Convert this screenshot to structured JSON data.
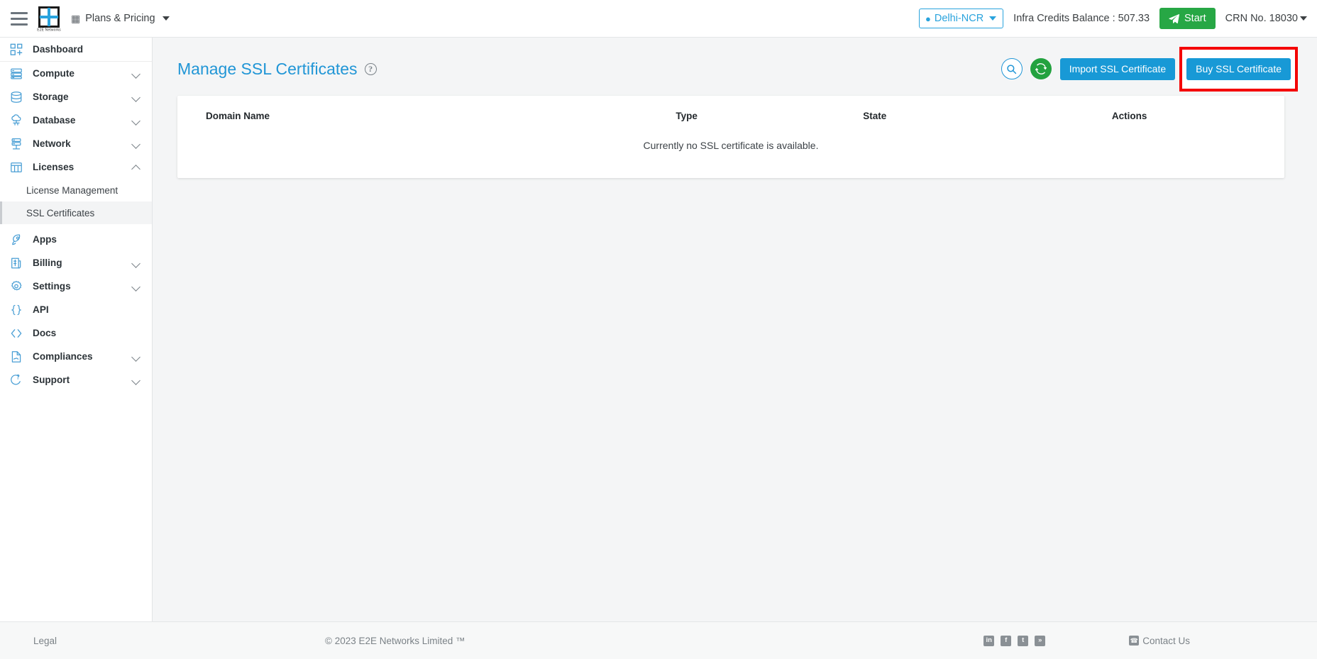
{
  "topbar": {
    "menu_icon": "hamburger-icon",
    "logo_text": "E2E Networks",
    "plans_label": "Plans & Pricing",
    "plans_icon": "list-icon",
    "region": "Delhi-NCR",
    "region_icon": "map-pin-icon",
    "credits_label": "Infra Credits Balance : 507.33",
    "start_label": "Start",
    "start_icon": "paper-plane-icon",
    "crn_label": "CRN No. 18030"
  },
  "sidebar": {
    "items": [
      {
        "label": "Dashboard",
        "icon": "dashboard-icon",
        "expandable": false,
        "state": ""
      },
      {
        "label": "Compute",
        "icon": "server-icon",
        "expandable": true,
        "state": "collapsed"
      },
      {
        "label": "Storage",
        "icon": "database-icon",
        "expandable": true,
        "state": "collapsed"
      },
      {
        "label": "Database",
        "icon": "cloud-db-icon",
        "expandable": true,
        "state": "collapsed"
      },
      {
        "label": "Network",
        "icon": "network-icon",
        "expandable": true,
        "state": "collapsed"
      },
      {
        "label": "Licenses",
        "icon": "grid-icon",
        "expandable": true,
        "state": "expanded"
      },
      {
        "label": "Apps",
        "icon": "rocket-icon",
        "expandable": false,
        "state": ""
      },
      {
        "label": "Billing",
        "icon": "invoice-icon",
        "expandable": true,
        "state": "collapsed"
      },
      {
        "label": "Settings",
        "icon": "gear-icon",
        "expandable": true,
        "state": "collapsed"
      },
      {
        "label": "API",
        "icon": "braces-icon",
        "expandable": false,
        "state": ""
      },
      {
        "label": "Docs",
        "icon": "code-icon",
        "expandable": false,
        "state": ""
      },
      {
        "label": "Compliances",
        "icon": "document-icon",
        "expandable": true,
        "state": "collapsed"
      },
      {
        "label": "Support",
        "icon": "lifebuoy-icon",
        "expandable": true,
        "state": "collapsed"
      }
    ],
    "licenses_sub": [
      {
        "label": "License Management",
        "active": false
      },
      {
        "label": "SSL Certificates",
        "active": true
      }
    ]
  },
  "main": {
    "title": "Manage SSL Certificates",
    "help_icon": "question-mark-icon",
    "search_icon": "search-icon",
    "refresh_icon": "refresh-icon",
    "import_label": "Import SSL Certificate",
    "buy_label": "Buy SSL Certificate",
    "table": {
      "headers": [
        "Domain Name",
        "Type",
        "State",
        "Actions"
      ],
      "rows": [],
      "empty_message": "Currently no SSL certificate is available."
    }
  },
  "footer": {
    "legal": "Legal",
    "copyright": "© 2023 E2E Networks Limited ™",
    "social": [
      {
        "name": "linkedin-icon",
        "glyph": "in"
      },
      {
        "name": "facebook-icon",
        "glyph": "f"
      },
      {
        "name": "twitter-icon",
        "glyph": "t"
      },
      {
        "name": "rss-icon",
        "glyph": "»"
      }
    ],
    "contact_label": "Contact Us",
    "contact_icon": "phone-icon"
  },
  "colors": {
    "accent_blue": "#2196d6",
    "button_blue": "#1899d6",
    "green": "#27a745",
    "refresh_green": "#23a23f",
    "highlight_red": "#f40000",
    "page_bg": "#f4f5f6"
  }
}
